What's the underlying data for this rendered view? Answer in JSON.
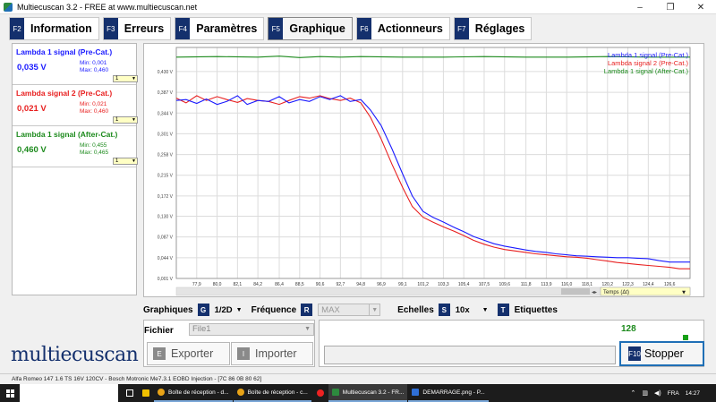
{
  "window": {
    "title": "Multiecuscan 3.2 - FREE at www.multiecuscan.net",
    "minimize": "–",
    "maximize": "❐",
    "close": "✕"
  },
  "tabs": [
    {
      "key": "F2",
      "label": "Information"
    },
    {
      "key": "F3",
      "label": "Erreurs"
    },
    {
      "key": "F4",
      "label": "Paramètres"
    },
    {
      "key": "F5",
      "label": "Graphique",
      "active": true
    },
    {
      "key": "F6",
      "label": "Actionneurs"
    },
    {
      "key": "F7",
      "label": "Réglages"
    }
  ],
  "signals": [
    {
      "name": "Lambda 1 signal (Pre-Cat.)",
      "value": "0,035 V",
      "min": "Min: 0,001",
      "max": "Max: 0,460",
      "scale": "1",
      "color": "#1a1aff"
    },
    {
      "name": "Lambda signal 2 (Pre-Cat.)",
      "value": "0,021 V",
      "min": "Min: 0,021",
      "max": "Max: 0,460",
      "scale": "1",
      "color": "#e82020"
    },
    {
      "name": "Lambda 1 signal (After-Cat.)",
      "value": "0,460 V",
      "min": "Min: 0,455",
      "max": "Max: 0,465",
      "scale": "1",
      "color": "#1c8a1c"
    }
  ],
  "chart_data": {
    "type": "line",
    "xlabel": "Temps (Δt)",
    "ylim": [
      0.001,
      0.48
    ],
    "yticks": [
      "0,001 V",
      "0,044 V",
      "0,087 V",
      "0,130 V",
      "0,172 V",
      "0,215 V",
      "0,258 V",
      "0,301 V",
      "0,344 V",
      "0,387 V",
      "0,430 V"
    ],
    "xticks": [
      "77,9",
      "80,0",
      "82,1",
      "84,2",
      "86,4",
      "88,5",
      "90,6",
      "92,7",
      "94,8",
      "96,9",
      "99,1",
      "101,2",
      "103,3",
      "105,4",
      "107,5",
      "109,6",
      "111,8",
      "113,9",
      "116,0",
      "118,1",
      "120,2",
      "122,3",
      "124,4",
      "126,6"
    ],
    "xlim": [
      75.8,
      128.7
    ],
    "grid": true,
    "legend": "top-right",
    "series": [
      {
        "name": "Lambda 1 signal (Pre-Cat.)",
        "color": "#1a1aff",
        "x": [
          75.8,
          76.8,
          77.9,
          78.9,
          80.0,
          81.0,
          82.1,
          83.1,
          84.2,
          85.3,
          86.4,
          87.4,
          88.5,
          89.5,
          90.6,
          91.6,
          92.7,
          93.7,
          94.8,
          95.8,
          96.9,
          98.0,
          99.1,
          100.1,
          101.2,
          102.2,
          103.3,
          104.3,
          105.4,
          106.4,
          107.5,
          108.5,
          109.6,
          110.7,
          111.8,
          112.8,
          113.9,
          114.9,
          116.0,
          117.0,
          118.1,
          119.1,
          120.2,
          121.2,
          122.3,
          123.3,
          124.4,
          125.5,
          126.6,
          127.6,
          128.7
        ],
        "y": [
          0.37,
          0.372,
          0.364,
          0.373,
          0.362,
          0.368,
          0.38,
          0.362,
          0.37,
          0.368,
          0.378,
          0.365,
          0.372,
          0.368,
          0.378,
          0.372,
          0.38,
          0.368,
          0.372,
          0.35,
          0.318,
          0.27,
          0.218,
          0.172,
          0.14,
          0.128,
          0.118,
          0.108,
          0.098,
          0.088,
          0.08,
          0.073,
          0.068,
          0.064,
          0.06,
          0.057,
          0.055,
          0.052,
          0.05,
          0.048,
          0.047,
          0.046,
          0.045,
          0.044,
          0.044,
          0.043,
          0.042,
          0.038,
          0.035,
          0.035,
          0.035
        ]
      },
      {
        "name": "Lambda signal 2 (Pre-Cat.)",
        "color": "#e82020",
        "x": [
          75.8,
          76.8,
          77.9,
          78.9,
          80.0,
          81.0,
          82.1,
          83.1,
          84.2,
          85.3,
          86.4,
          87.4,
          88.5,
          89.5,
          90.6,
          91.6,
          92.7,
          93.7,
          94.8,
          95.8,
          96.9,
          98.0,
          99.1,
          100.1,
          101.2,
          102.2,
          103.3,
          104.3,
          105.4,
          106.4,
          107.5,
          108.5,
          109.6,
          110.7,
          111.8,
          112.8,
          113.9,
          114.9,
          116.0,
          117.0,
          118.1,
          119.1,
          120.2,
          121.2,
          122.3,
          123.3,
          124.4,
          125.5,
          126.6,
          127.6,
          128.7
        ],
        "y": [
          0.375,
          0.365,
          0.38,
          0.37,
          0.378,
          0.372,
          0.366,
          0.374,
          0.37,
          0.368,
          0.362,
          0.37,
          0.378,
          0.375,
          0.38,
          0.374,
          0.37,
          0.375,
          0.365,
          0.335,
          0.29,
          0.238,
          0.19,
          0.15,
          0.128,
          0.118,
          0.108,
          0.1,
          0.09,
          0.08,
          0.072,
          0.066,
          0.061,
          0.058,
          0.055,
          0.052,
          0.05,
          0.048,
          0.046,
          0.045,
          0.043,
          0.04,
          0.037,
          0.034,
          0.032,
          0.03,
          0.028,
          0.026,
          0.024,
          0.021,
          0.021
        ]
      },
      {
        "name": "Lambda 1 signal (After-Cat.)",
        "color": "#1c8a1c",
        "x": [
          75.8,
          80.0,
          84.2,
          86.4,
          88.5,
          90.6,
          92.7,
          94.8,
          99.1,
          103.3,
          107.5,
          111.8,
          116.0,
          120.2,
          124.4,
          128.7
        ],
        "y": [
          0.46,
          0.461,
          0.46,
          0.462,
          0.459,
          0.461,
          0.46,
          0.461,
          0.46,
          0.46,
          0.461,
          0.46,
          0.46,
          0.461,
          0.46,
          0.46
        ]
      }
    ]
  },
  "controls": {
    "graphiques_label": "Graphiques",
    "graphiques_key": "G",
    "graphiques_value": "1/2D",
    "frequence_label": "Fréquence",
    "frequence_key": "R",
    "frequence_value": "MAX",
    "echelles_label": "Echelles",
    "echelles_key": "S",
    "echelles_value": "10x",
    "etiquettes_key": "T",
    "etiquettes_label": "Etiquettes"
  },
  "file": {
    "label": "Fichier",
    "value": "File1",
    "export_key": "E",
    "export_label": "Exporter",
    "import_key": "I",
    "import_label": "Importer"
  },
  "status": {
    "count": "128",
    "stop_key": "F10",
    "stop_label": "Stopper"
  },
  "logo": "multiecuscan",
  "statusbar": "Alfa Romeo 147 1.6 TS 16V 120CV - Bosch Motronic Me7.3.1 EOBD Injection - [7C 86 0B 80 62]",
  "taskbar": {
    "apps": [
      {
        "label": "Boîte de réception - d...",
        "color": "#e8a317"
      },
      {
        "label": "Boîte de réception - c...",
        "color": "#e8a317"
      },
      {
        "label": "Multiecuscan 3.2 - FR...",
        "color": "#2d8a3e",
        "active": true
      },
      {
        "label": "DEMARRAGE.png - P...",
        "color": "#2f6fd6"
      }
    ],
    "language": "FRA",
    "time": "14:27"
  }
}
